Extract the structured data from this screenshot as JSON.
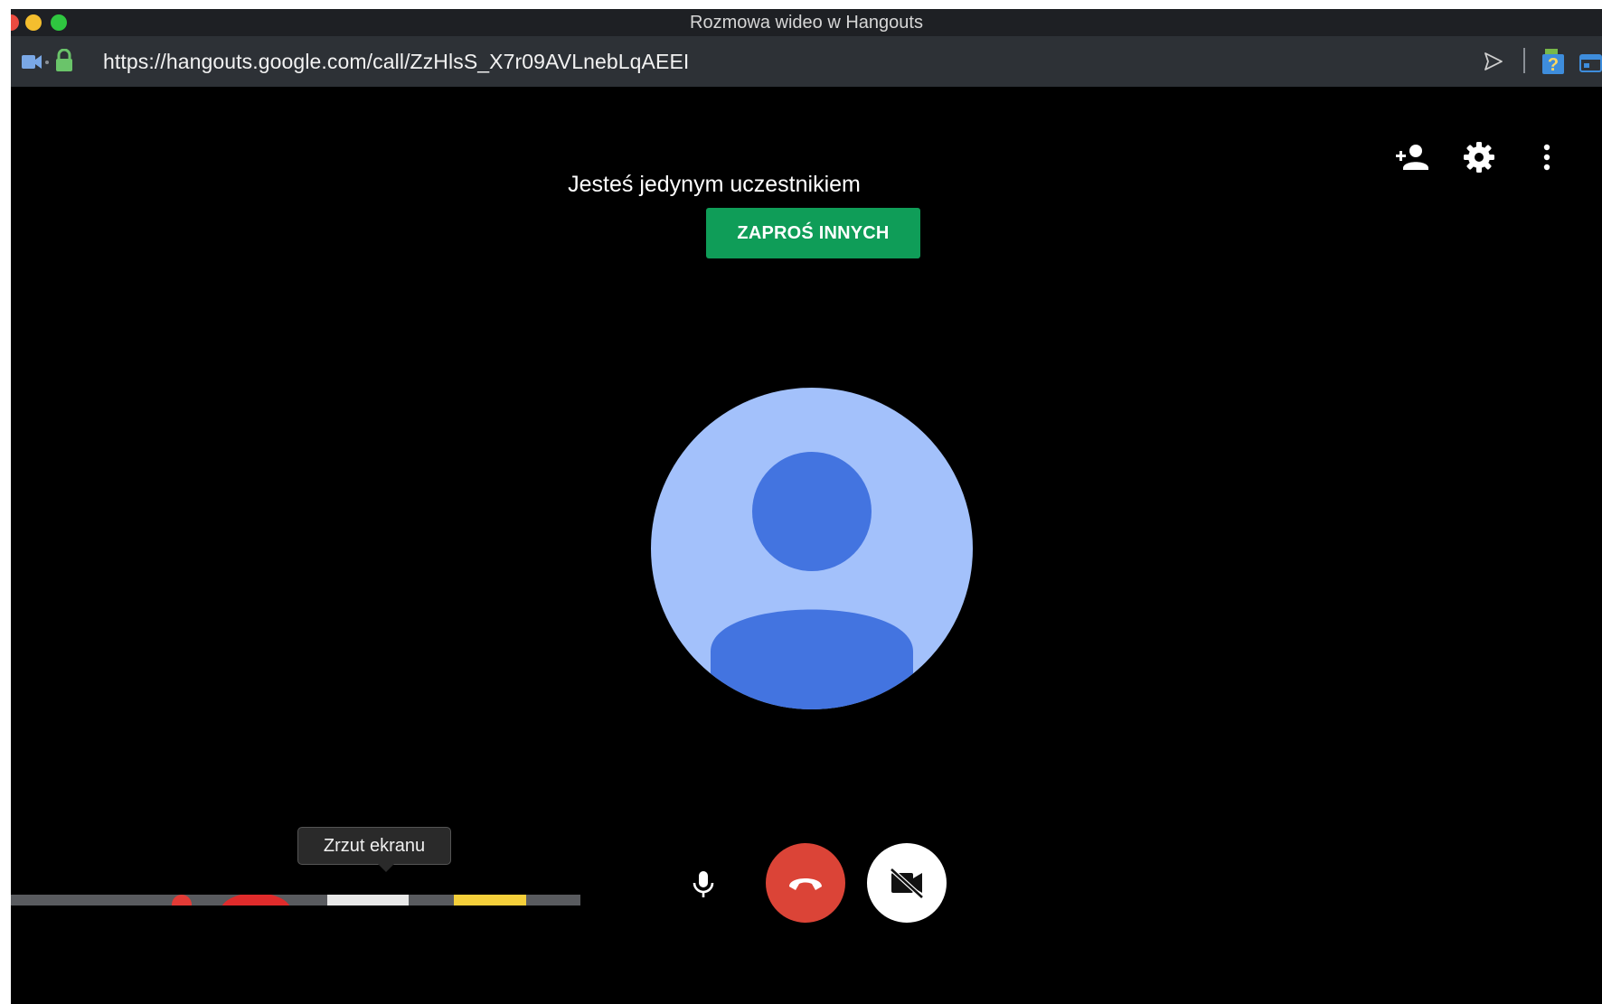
{
  "window": {
    "title": "Rozmowa wideo w Hangouts"
  },
  "address_bar": {
    "url": "https://hangouts.google.com/call/ZzHlsS_X7r09AVLnebLqAEEI",
    "left_icons": [
      "video-camera-icon",
      "lock-icon"
    ],
    "right_icons": [
      "send-icon",
      "extension-help-icon",
      "extension-window-icon"
    ]
  },
  "call": {
    "status_text": "Jesteś jedynym uczestnikiem",
    "invite_label": "ZAPROŚ INNYCH",
    "top_actions": [
      "add-person-icon",
      "gear-icon",
      "more-vertical-icon"
    ],
    "controls": [
      "microphone-icon",
      "hang-up-icon",
      "video-off-icon"
    ]
  },
  "tooltip": {
    "text": "Zrzut ekranu"
  },
  "colors": {
    "invite_green": "#0f9d58",
    "hangup_red": "#db4437",
    "avatar_light": "#a3c1fb",
    "avatar_dark": "#4374e0",
    "lock_green": "#6ac46a"
  }
}
